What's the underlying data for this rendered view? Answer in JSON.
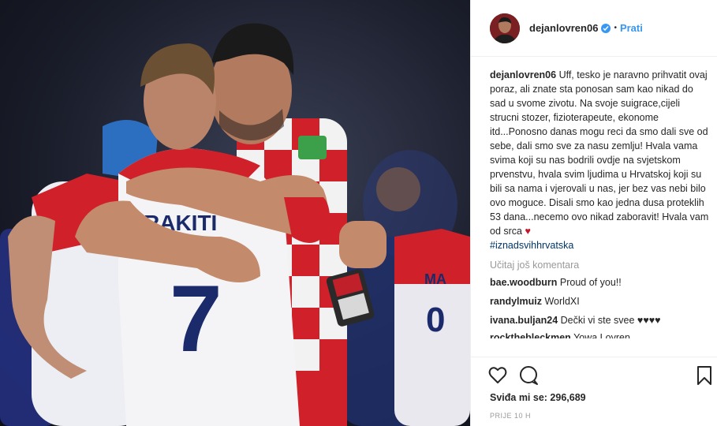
{
  "photo": {
    "jersey_name": "RAKITI",
    "jersey_number": "7",
    "description_icon": "photo"
  },
  "header": {
    "username": "dejanlovren06",
    "dot": "•",
    "follow_label": "Prati"
  },
  "caption": {
    "username": "dejanlovren06",
    "text": "Uff, tesko je naravno prihvatit ovaj poraz, ali znate sta ponosan sam kao nikad do sad u svome zivotu. Na svoje suigrace,cijeli strucni stozer, fizioterapeute, ekonome itd...Ponosno danas mogu reci da smo dali sve od sebe, dali smo sve za nasu zemlju! Hvala vama svima koji su nas bodrili ovdje na svjetskom prvenstvu, hvala svim ljudima u Hrvatskoj koji su bili sa nama i vjerovali u nas, jer bez vas nebi bilo ovo moguce. Disali smo kao jedna dusa proteklih 53 dana...necemo ovo nikad zaboravit! Hvala vam od srca ",
    "heart": "♥",
    "hashtag": "#iznadsvihhrvatska"
  },
  "load_more": "Učitaj još komentara",
  "comments": [
    {
      "username": "bae.woodburn",
      "text": "Proud of you!!"
    },
    {
      "username": "randylmuiz",
      "text": "WorldXI"
    },
    {
      "username": "ivana.buljan24",
      "text": "Dečki vi ste svee ♥♥♥♥"
    },
    {
      "username": "rockthebleckmen",
      "text": "Yowa Lovren"
    }
  ],
  "actions": {
    "likes": "Sviđa mi se: 296,689",
    "time": "PRIJE 10 H"
  },
  "colors": {
    "link": "#3897f0",
    "hashtag": "#003569",
    "heart": "#c4162a"
  }
}
